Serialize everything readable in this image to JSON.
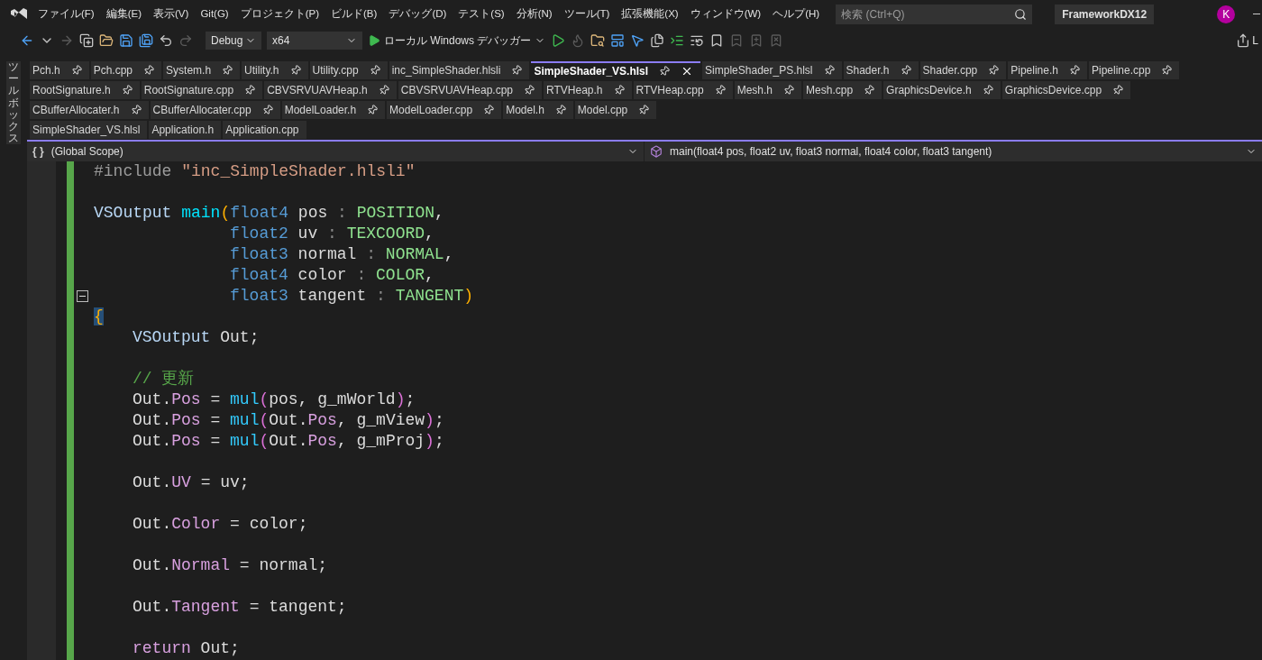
{
  "menu": [
    "ファイル(F)",
    "編集(E)",
    "表示(V)",
    "Git(G)",
    "プロジェクト(P)",
    "ビルド(B)",
    "デバッグ(D)",
    "テスト(S)",
    "分析(N)",
    "ツール(T)",
    "拡張機能(X)",
    "ウィンドウ(W)",
    "ヘルプ(H)"
  ],
  "search": {
    "placeholder": "検索 (Ctrl+Q)"
  },
  "project": "FrameworkDX12",
  "avatar": "K",
  "toolbar": {
    "configuration": "Debug",
    "platform": "x64",
    "run": "ローカル Windows デバッガー",
    "live_share": "L"
  },
  "toolbox": "ツールボックス",
  "tab_rows": [
    [
      {
        "label": "Pch.h",
        "pinned": true,
        "selected": false
      },
      {
        "label": "Pch.cpp",
        "pinned": true,
        "selected": false
      },
      {
        "label": "System.h",
        "pinned": true,
        "selected": false
      },
      {
        "label": "Utility.h",
        "pinned": true,
        "selected": false
      },
      {
        "label": "Utility.cpp",
        "pinned": true,
        "selected": false
      },
      {
        "label": "inc_SimpleShader.hlsli",
        "pinned": true,
        "selected": false
      },
      {
        "label": "SimpleShader_VS.hlsl",
        "pinned": true,
        "selected": true
      },
      {
        "label": "SimpleShader_PS.hlsl",
        "pinned": true,
        "selected": false
      },
      {
        "label": "Shader.h",
        "pinned": true,
        "selected": false
      },
      {
        "label": "Shader.cpp",
        "pinned": true,
        "selected": false
      },
      {
        "label": "Pipeline.h",
        "pinned": true,
        "selected": false
      },
      {
        "label": "Pipeline.cpp",
        "pinned": true,
        "selected": false
      }
    ],
    [
      {
        "label": "RootSignature.h",
        "pinned": true,
        "selected": false
      },
      {
        "label": "RootSignature.cpp",
        "pinned": true,
        "selected": false
      },
      {
        "label": "CBVSRVUAVHeap.h",
        "pinned": true,
        "selected": false
      },
      {
        "label": "CBVSRVUAVHeap.cpp",
        "pinned": true,
        "selected": false
      },
      {
        "label": "RTVHeap.h",
        "pinned": true,
        "selected": false
      },
      {
        "label": "RTVHeap.cpp",
        "pinned": true,
        "selected": false
      },
      {
        "label": "Mesh.h",
        "pinned": true,
        "selected": false
      },
      {
        "label": "Mesh.cpp",
        "pinned": true,
        "selected": false
      },
      {
        "label": "GraphicsDevice.h",
        "pinned": true,
        "selected": false
      },
      {
        "label": "GraphicsDevice.cpp",
        "pinned": true,
        "selected": false
      }
    ],
    [
      {
        "label": "CBufferAllocater.h",
        "pinned": true,
        "selected": false
      },
      {
        "label": "CBufferAllocater.cpp",
        "pinned": true,
        "selected": false
      },
      {
        "label": "ModelLoader.h",
        "pinned": true,
        "selected": false
      },
      {
        "label": "ModelLoader.cpp",
        "pinned": true,
        "selected": false
      },
      {
        "label": "Model.h",
        "pinned": true,
        "selected": false
      },
      {
        "label": "Model.cpp",
        "pinned": true,
        "selected": false
      }
    ],
    [
      {
        "label": "SimpleShader_VS.hlsl",
        "pinned": false,
        "selected": false
      },
      {
        "label": "Application.h",
        "pinned": false,
        "selected": false
      },
      {
        "label": "Application.cpp",
        "pinned": false,
        "selected": false
      }
    ]
  ],
  "scope": {
    "icon": "{ }",
    "left": "(Global Scope)",
    "right": "main(float4 pos, float2 uv, float3 normal, float4 color, float3 tangent)"
  },
  "code_lines": [
    {
      "kind": "top",
      "tokens": [
        {
          "kind": "directive",
          "text": "#include "
        },
        {
          "kind": "string",
          "text": "\"inc_SimpleShader.hlsli\""
        }
      ]
    },
    {
      "kind": "blank"
    },
    {
      "kind": "top",
      "tokens": [
        {
          "kind": "struct",
          "text": "VSOutput "
        },
        {
          "kind": "func",
          "text": "main"
        },
        {
          "kind": "paren",
          "text": "("
        },
        {
          "kind": "type",
          "text": "float4"
        },
        {
          "kind": "plain",
          "text": " pos "
        },
        {
          "kind": "punct",
          "text": ":"
        },
        {
          "kind": "semantic",
          "text": " POSITION"
        },
        {
          "kind": "plain",
          "text": ","
        }
      ]
    },
    {
      "kind": "params",
      "tokens": [
        {
          "kind": "type",
          "text": "float2"
        },
        {
          "kind": "plain",
          "text": " uv "
        },
        {
          "kind": "punct",
          "text": ":"
        },
        {
          "kind": "semantic",
          "text": " TEXCOORD"
        },
        {
          "kind": "plain",
          "text": ","
        }
      ]
    },
    {
      "kind": "params",
      "tokens": [
        {
          "kind": "type",
          "text": "float3"
        },
        {
          "kind": "plain",
          "text": " normal "
        },
        {
          "kind": "punct",
          "text": ":"
        },
        {
          "kind": "semantic",
          "text": " NORMAL"
        },
        {
          "kind": "plain",
          "text": ","
        }
      ]
    },
    {
      "kind": "params",
      "tokens": [
        {
          "kind": "type",
          "text": "float4"
        },
        {
          "kind": "plain",
          "text": " color "
        },
        {
          "kind": "punct",
          "text": ":"
        },
        {
          "kind": "semantic",
          "text": " COLOR"
        },
        {
          "kind": "plain",
          "text": ","
        }
      ]
    },
    {
      "kind": "params",
      "expanded": true,
      "tokens": [
        {
          "kind": "type",
          "text": "float3"
        },
        {
          "kind": "plain",
          "text": " tangent "
        },
        {
          "kind": "punct",
          "text": ":"
        },
        {
          "kind": "semantic",
          "text": " TANGENT"
        },
        {
          "kind": "paren",
          "text": ")"
        }
      ]
    },
    {
      "kind": "top",
      "tokens": [
        {
          "kind": "brace",
          "text": "{"
        }
      ]
    },
    {
      "kind": "body",
      "tokens": [
        {
          "kind": "struct",
          "text": "VSOutput"
        },
        {
          "kind": "plain",
          "text": " Out;"
        }
      ]
    },
    {
      "kind": "blank"
    },
    {
      "kind": "body",
      "tokens": [
        {
          "kind": "comment",
          "text": "// 更新"
        }
      ]
    },
    {
      "kind": "body",
      "tokens": [
        {
          "kind": "plain",
          "text": "Out."
        },
        {
          "kind": "member",
          "text": "Pos"
        },
        {
          "kind": "plain",
          "text": " = "
        },
        {
          "kind": "intrinsic",
          "text": "mul"
        },
        {
          "kind": "mparen",
          "text": "("
        },
        {
          "kind": "plain",
          "text": "pos, g_mWorld"
        },
        {
          "kind": "mparen",
          "text": ")"
        },
        {
          "kind": "plain",
          "text": ";"
        }
      ]
    },
    {
      "kind": "body",
      "tokens": [
        {
          "kind": "plain",
          "text": "Out."
        },
        {
          "kind": "member",
          "text": "Pos"
        },
        {
          "kind": "plain",
          "text": " = "
        },
        {
          "kind": "intrinsic",
          "text": "mul"
        },
        {
          "kind": "mparen",
          "text": "("
        },
        {
          "kind": "plain",
          "text": "Out."
        },
        {
          "kind": "member",
          "text": "Pos"
        },
        {
          "kind": "plain",
          "text": ", g_mView"
        },
        {
          "kind": "mparen",
          "text": ")"
        },
        {
          "kind": "plain",
          "text": ";"
        }
      ]
    },
    {
      "kind": "body",
      "tokens": [
        {
          "kind": "plain",
          "text": "Out."
        },
        {
          "kind": "member",
          "text": "Pos"
        },
        {
          "kind": "plain",
          "text": " = "
        },
        {
          "kind": "intrinsic",
          "text": "mul"
        },
        {
          "kind": "mparen",
          "text": "("
        },
        {
          "kind": "plain",
          "text": "Out."
        },
        {
          "kind": "member",
          "text": "Pos"
        },
        {
          "kind": "plain",
          "text": ", g_mProj"
        },
        {
          "kind": "mparen",
          "text": ")"
        },
        {
          "kind": "plain",
          "text": ";"
        }
      ]
    },
    {
      "kind": "blank"
    },
    {
      "kind": "body",
      "tokens": [
        {
          "kind": "plain",
          "text": "Out."
        },
        {
          "kind": "member",
          "text": "UV"
        },
        {
          "kind": "plain",
          "text": " = uv;"
        }
      ]
    },
    {
      "kind": "blank"
    },
    {
      "kind": "body",
      "tokens": [
        {
          "kind": "plain",
          "text": "Out."
        },
        {
          "kind": "member",
          "text": "Color"
        },
        {
          "kind": "plain",
          "text": " = color;"
        }
      ]
    },
    {
      "kind": "blank"
    },
    {
      "kind": "body",
      "tokens": [
        {
          "kind": "plain",
          "text": "Out."
        },
        {
          "kind": "member",
          "text": "Normal"
        },
        {
          "kind": "plain",
          "text": " = normal;"
        }
      ]
    },
    {
      "kind": "blank"
    },
    {
      "kind": "body",
      "tokens": [
        {
          "kind": "plain",
          "text": "Out."
        },
        {
          "kind": "member",
          "text": "Tangent"
        },
        {
          "kind": "plain",
          "text": " = tangent;"
        }
      ]
    },
    {
      "kind": "blank"
    },
    {
      "kind": "body",
      "tokens": [
        {
          "kind": "keyword",
          "text": "return"
        },
        {
          "kind": "plain",
          "text": " Out;"
        }
      ]
    }
  ]
}
